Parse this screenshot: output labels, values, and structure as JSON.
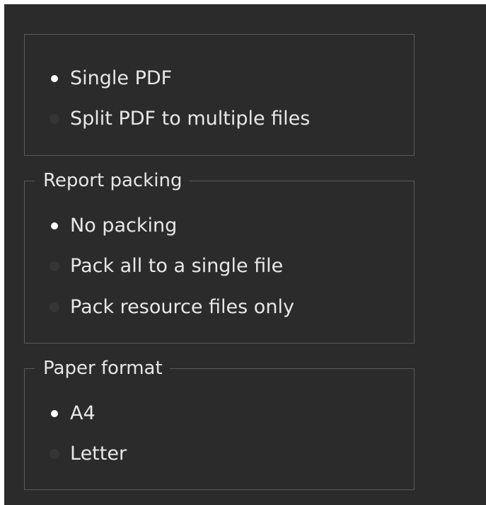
{
  "output_group": {
    "options": [
      {
        "label": "Single PDF",
        "selected": true
      },
      {
        "label": "Split PDF to multiple files",
        "selected": false
      }
    ]
  },
  "packing_group": {
    "title": "Report packing",
    "options": [
      {
        "label": "No packing",
        "selected": true
      },
      {
        "label": "Pack all to a single file",
        "selected": false
      },
      {
        "label": "Pack resource files only",
        "selected": false
      }
    ]
  },
  "paper_group": {
    "title": "Paper format",
    "options": [
      {
        "label": "A4",
        "selected": true
      },
      {
        "label": "Letter",
        "selected": false
      }
    ]
  },
  "colors": {
    "background": "#2b2b2b",
    "border": "#5a5a5a",
    "text": "#e6e6e6",
    "radio_selected": "#ffffff",
    "radio_unselected": "#353535"
  }
}
